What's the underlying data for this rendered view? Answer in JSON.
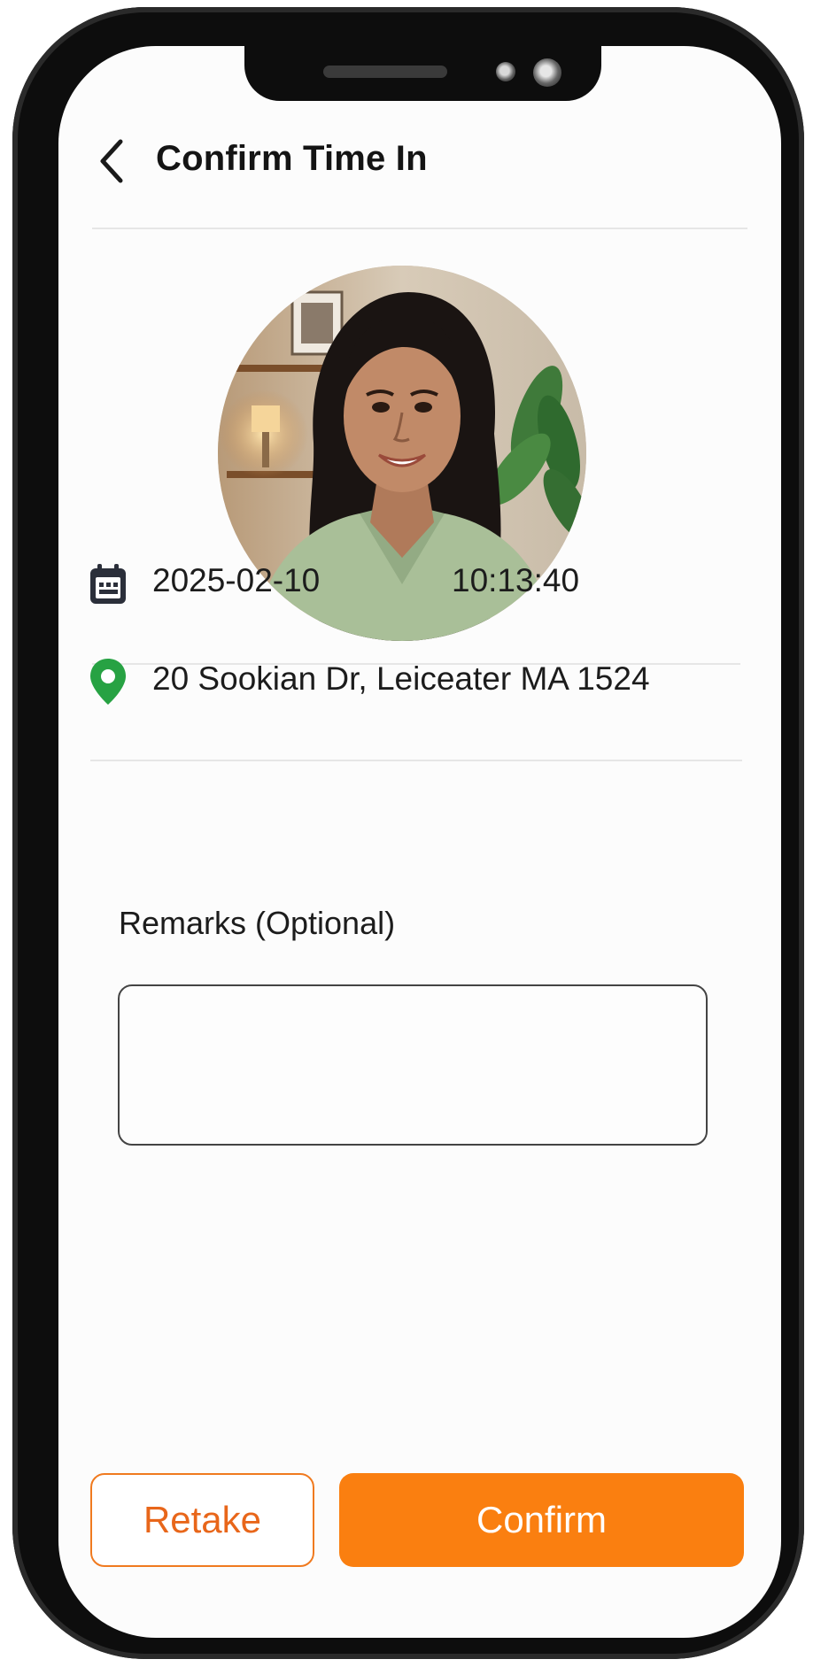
{
  "header": {
    "title": "Confirm Time In",
    "back_icon": "chevron-left-icon"
  },
  "photo": {
    "description_icon": "user-photo"
  },
  "timestamp": {
    "date": "2025-02-10",
    "time": "10:13:40",
    "icon": "calendar-icon"
  },
  "location": {
    "address": "20 Sookian Dr, Leiceater MA 1524",
    "icon": "map-pin-icon",
    "icon_color": "#27a243"
  },
  "remarks": {
    "label": "Remarks (Optional)",
    "value": ""
  },
  "actions": {
    "retake_label": "Retake",
    "confirm_label": "Confirm",
    "accent_color": "#fa7f10"
  }
}
